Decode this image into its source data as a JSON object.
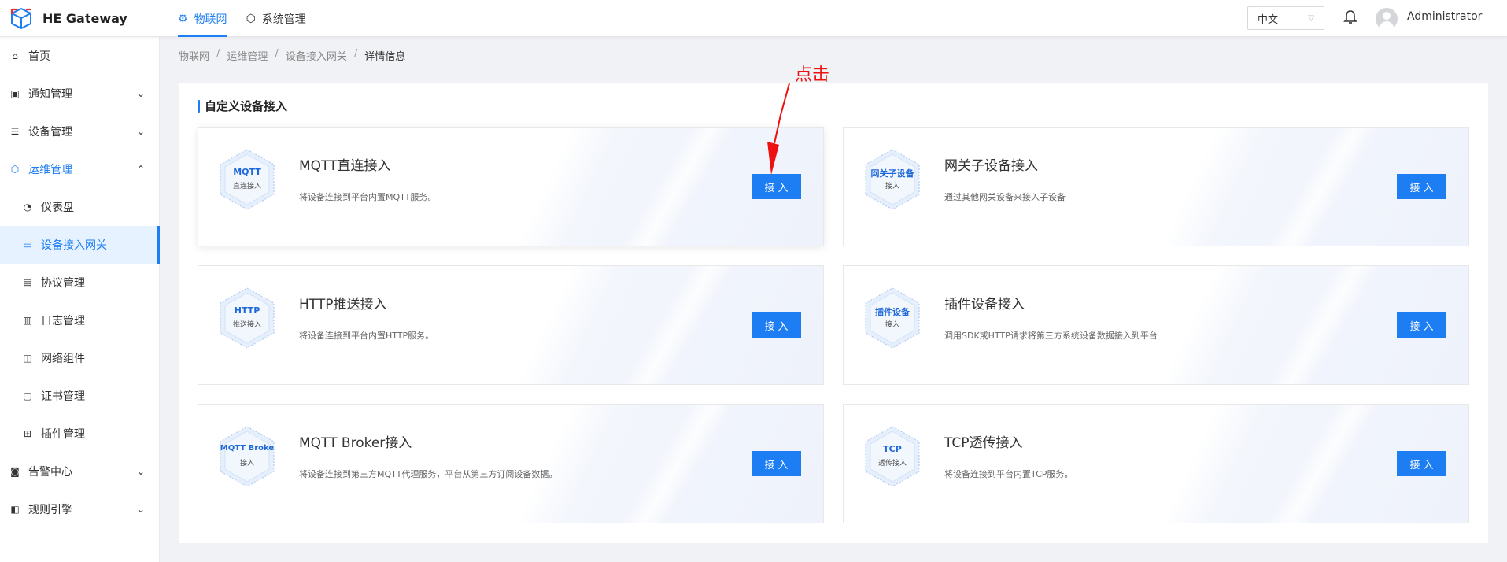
{
  "app": {
    "title": "HE Gateway"
  },
  "topnav": {
    "items": [
      {
        "label": "物联网",
        "icon": "iot-icon"
      },
      {
        "label": "系统管理",
        "icon": "system-icon"
      }
    ]
  },
  "header": {
    "language": "中文",
    "username": "Administrator"
  },
  "sidebar": {
    "items": [
      {
        "label": "首页",
        "icon": "home-icon"
      },
      {
        "label": "通知管理",
        "icon": "notification-icon"
      },
      {
        "label": "设备管理",
        "icon": "device-icon"
      },
      {
        "label": "运维管理",
        "icon": "ops-icon"
      },
      {
        "label": "仪表盘",
        "icon": "dashboard-icon"
      },
      {
        "label": "设备接入网关",
        "icon": "gateway-icon"
      },
      {
        "label": "协议管理",
        "icon": "protocol-icon"
      },
      {
        "label": "日志管理",
        "icon": "log-icon"
      },
      {
        "label": "网络组件",
        "icon": "network-icon"
      },
      {
        "label": "证书管理",
        "icon": "certificate-icon"
      },
      {
        "label": "插件管理",
        "icon": "plugin-icon"
      },
      {
        "label": "告警中心",
        "icon": "alarm-icon"
      },
      {
        "label": "规则引擎",
        "icon": "rule-icon"
      }
    ]
  },
  "breadcrumb": {
    "items": [
      "物联网",
      "运维管理",
      "设备接入网关",
      "详情信息"
    ],
    "separator": "/"
  },
  "main": {
    "section_title": "自定义设备接入",
    "button_label": "接入",
    "cards": [
      {
        "hex_title": "MQTT",
        "hex_sub": "直连接入",
        "title": "MQTT直连接入",
        "desc": "将设备连接到平台内置MQTT服务。"
      },
      {
        "hex_title": "网关子设备",
        "hex_sub": "接入",
        "title": "网关子设备接入",
        "desc": "通过其他网关设备来接入子设备"
      },
      {
        "hex_title": "HTTP",
        "hex_sub": "推送接入",
        "title": "HTTP推送接入",
        "desc": "将设备连接到平台内置HTTP服务。"
      },
      {
        "hex_title": "插件设备",
        "hex_sub": "接入",
        "title": "插件设备接入",
        "desc": "调用SDK或HTTP请求将第三方系统设备数据接入到平台"
      },
      {
        "hex_title": "MQTT Broke",
        "hex_sub": "接入",
        "title": "MQTT Broker接入",
        "desc": "将设备连接到第三方MQTT代理服务，平台从第三方订阅设备数据。"
      },
      {
        "hex_title": "TCP",
        "hex_sub": "透传接入",
        "title": "TCP透传接入",
        "desc": "将设备连接到平台内置TCP服务。"
      }
    ]
  },
  "annotation": {
    "text": "点击",
    "color": "#e11111"
  },
  "colors": {
    "accent": "#1d7df2",
    "selected_bg": "#e6f2ff"
  }
}
